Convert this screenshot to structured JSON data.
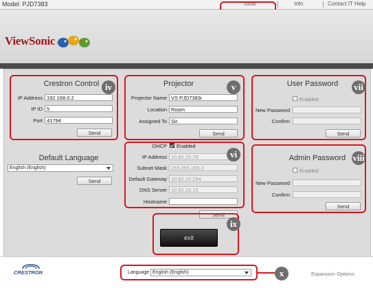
{
  "topbar": {
    "model": "Model: PJD7383",
    "tools": "Tools",
    "info": "Info",
    "contact": "Contact IT Help"
  },
  "header": {
    "logo": "ViewSonic"
  },
  "crestron_control": {
    "title": "Crestron Control",
    "ip_label": "IP Address",
    "ip_value": "192.168.0.2",
    "ipid_label": "IP ID",
    "ipid_value": "5",
    "port_label": "Port",
    "port_value": "41794",
    "send": "Send"
  },
  "projector": {
    "title": "Projector",
    "name_label": "Projector Name",
    "name_value": "VS PJD7383i",
    "location_label": "Location",
    "location_value": "Room",
    "assigned_label": "Assigned To",
    "assigned_value": "Sir.",
    "send": "Send"
  },
  "network": {
    "dhcp_label": "DHCP",
    "dhcp_enabled": "Enabled",
    "ip_label": "IP Address",
    "ip_value": "10.82.23.79",
    "subnet_label": "Subnet Mask",
    "subnet_value": "255.255.255.0",
    "gateway_label": "Default Gateway",
    "gateway_value": "10.82.23.254",
    "dns_label": "DNS Server",
    "dns_value": "10.82.15.15",
    "hostname_label": "Hostname",
    "hostname_value": "",
    "send": "Send"
  },
  "default_language": {
    "title": "Default Language",
    "selected": "English (English)",
    "send": "Send"
  },
  "user_password": {
    "title": "User Password",
    "enabled": "Enabled",
    "new_label": "New Password",
    "confirm_label": "Confirm",
    "send": "Send"
  },
  "admin_password": {
    "title": "Admin Password",
    "enabled": "Enabled",
    "new_label": "New Password",
    "confirm_label": "Confirm",
    "send": "Send"
  },
  "exit": {
    "label": "exit"
  },
  "footer": {
    "crestron": "CRESTRON",
    "language_label": "Language",
    "language_selected": "English (English)",
    "expansion": "Expansion Options"
  },
  "badges": {
    "iv": "iv",
    "v": "v",
    "vi": "vi",
    "vii": "vii",
    "viii": "viii",
    "ix": "ix",
    "x": "x"
  },
  "colors": {
    "callout": "#d9141c",
    "logo_red": "#a0191c",
    "badge": "#6e6e6e"
  }
}
